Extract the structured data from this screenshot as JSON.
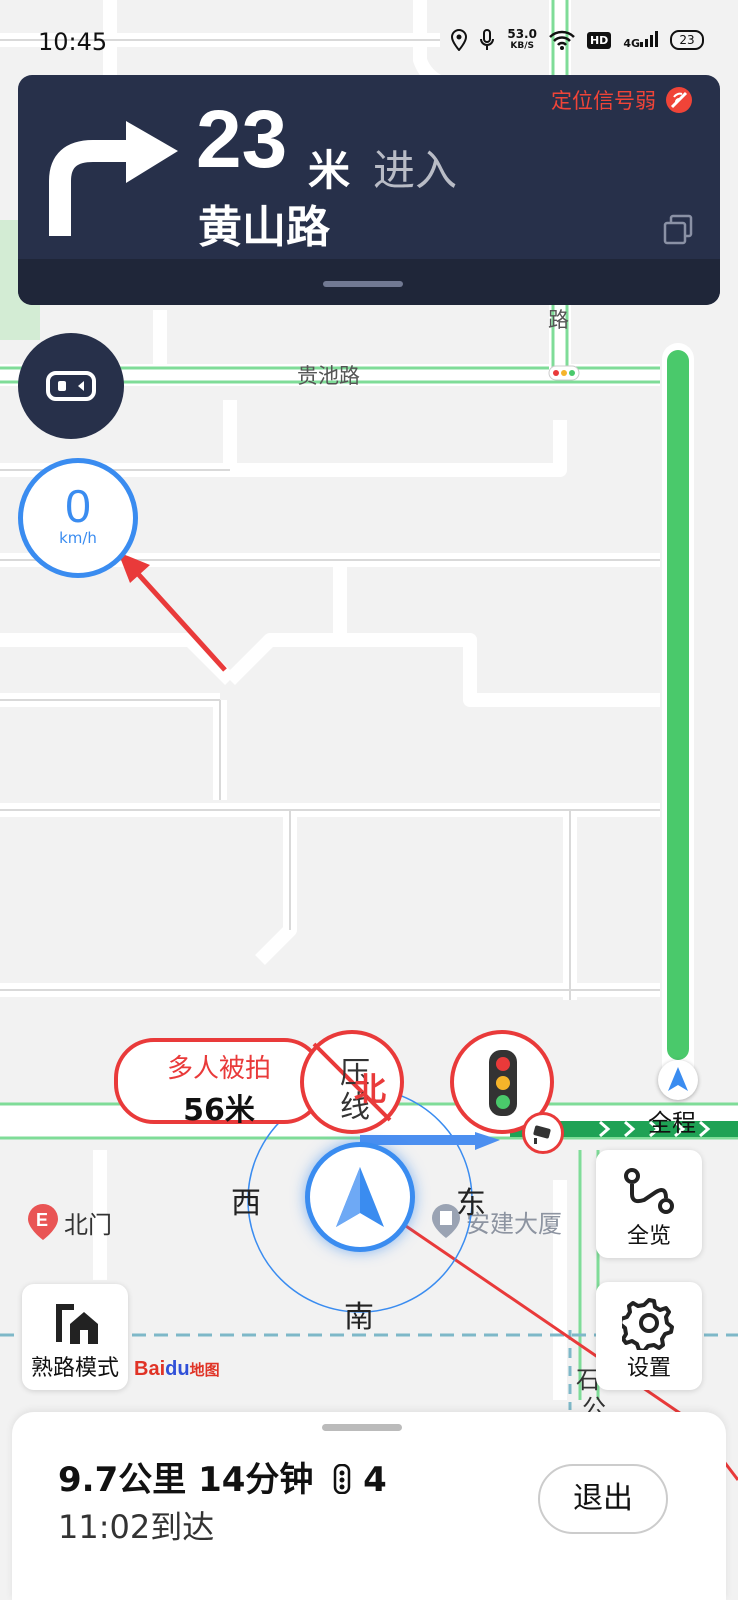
{
  "status_bar": {
    "time": "10:45",
    "net_speed": "53.0",
    "net_speed_unit": "KB/S",
    "hd": "HD",
    "signal": "4G",
    "battery": "23"
  },
  "guidance": {
    "distance": "23",
    "distance_unit": "米",
    "action": "进入",
    "road": "黄山路",
    "gps_warning": "定位信号弱"
  },
  "speedometer": {
    "speed": "0",
    "unit": "km/h"
  },
  "route_progress": {
    "remaining_fraction": 1.0,
    "label": "全程"
  },
  "map_labels": {
    "road_top": "路",
    "road_guichi": "贵池路",
    "poi_beimen": "北门",
    "poi_anjian": "安建大厦",
    "road_bottom1": "石",
    "road_bottom2": "公"
  },
  "camera_alert": {
    "text": "多人被拍",
    "distance": "56米",
    "lane_label1": "压",
    "lane_label2": "线"
  },
  "compass": {
    "north": "北",
    "south": "南",
    "east": "东",
    "west": "西"
  },
  "buttons": {
    "overview": "全览",
    "settings": "设置",
    "familiar_mode": "熟路模式",
    "exit": "退出"
  },
  "brand": {
    "bai": "Bai",
    "du": "du",
    "map": "地图"
  },
  "trip": {
    "summary": "9.7公里 14分钟",
    "traffic_lights": "4",
    "eta": "11:02到达"
  },
  "colors": {
    "nav_bg": "#27304a",
    "accent_blue": "#3a8cf0",
    "alert_red": "#e93a3a",
    "progress_green": "#4ac96b"
  }
}
